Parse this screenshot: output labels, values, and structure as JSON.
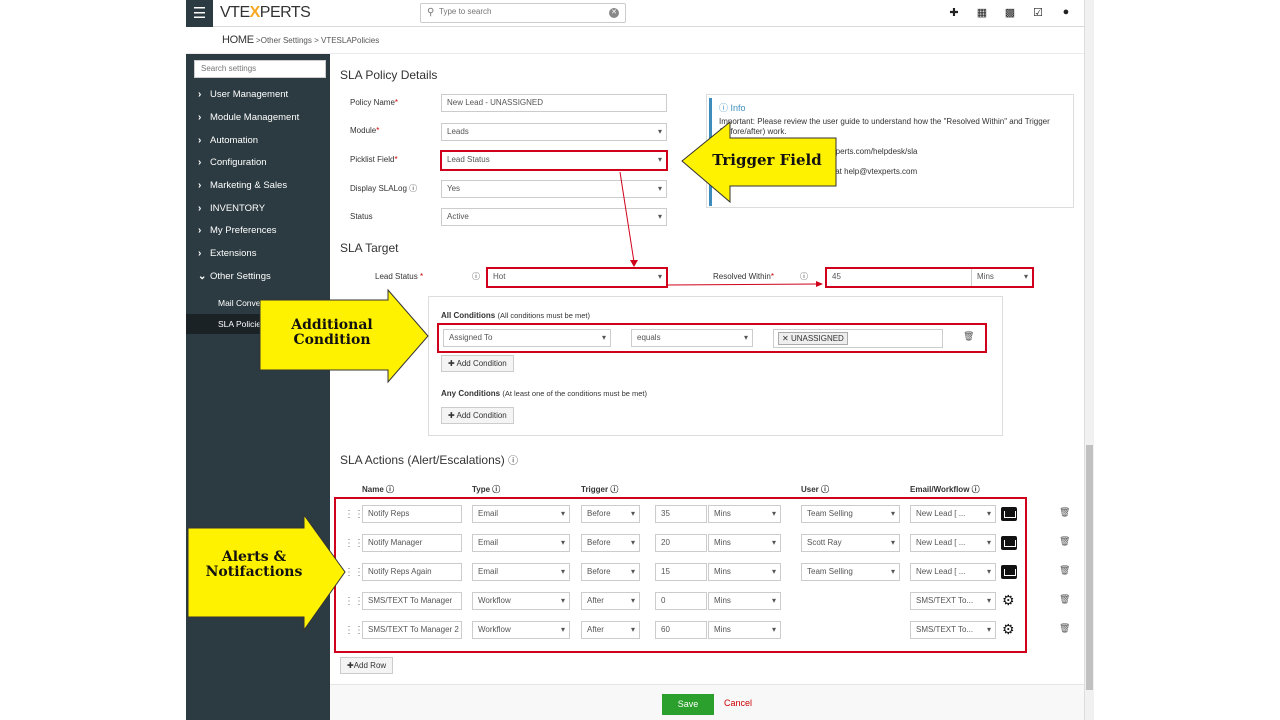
{
  "topbar": {
    "logo_pre": "VTE",
    "logo_x": "X",
    "logo_post": "PERTS",
    "search_placeholder": "Type to search"
  },
  "breadcrumb": {
    "home": "HOME",
    "sep1": " >",
    "item1": "Other Settings",
    "sep2": " > ",
    "item2": "VTESLAPolicies"
  },
  "sidebar": {
    "search_placeholder": "Search settings",
    "items": [
      "User Management",
      "Module Management",
      "Automation",
      "Configuration",
      "Marketing & Sales",
      "INVENTORY",
      "My Preferences",
      "Extensions",
      "Other Settings"
    ],
    "sub": [
      "Mail Converter",
      "SLA Policies"
    ]
  },
  "policy": {
    "title": "SLA Policy Details",
    "fields": [
      {
        "label": "Policy Name",
        "req": "*",
        "value": "New Lead - UNASSIGNED"
      },
      {
        "label": "Module",
        "req": "*",
        "value": "Leads"
      },
      {
        "label": "Picklist Field",
        "req": "*",
        "value": "Lead Status"
      },
      {
        "label": "Display SLALog",
        "req": "",
        "value": "Yes"
      },
      {
        "label": "Status",
        "req": "",
        "value": "Active"
      }
    ]
  },
  "info": {
    "title": "Info",
    "line1": "Important: Please review the user guide to understand how the \"Resolved Within\" and Trigger",
    "line2": "(before/after) work.",
    "line3": "texperts.com/helpdesk/sla",
    "line4": "ail at help@vtexperts.com"
  },
  "target": {
    "title": "SLA Target",
    "lead_status_label": "Lead Status",
    "lead_status_value": "Hot",
    "resolved_label": "Resolved Within",
    "resolved_value": "45",
    "resolved_unit": "Mins"
  },
  "conditions": {
    "all_title": "All Conditions",
    "all_note": "(All conditions must be met)",
    "field": "Assigned To",
    "op": "equals",
    "tag": "UNASSIGNED",
    "add": "Add Condition",
    "any_title": "Any Conditions",
    "any_note": "(At least one of the conditions must be met)"
  },
  "actions": {
    "title": "SLA Actions (Alert/Escalations)",
    "cols": [
      "Name",
      "Type",
      "Trigger",
      "User",
      "Email/Workflow"
    ],
    "rows": [
      {
        "name": "Notify Reps",
        "type": "Email",
        "trigger": "Before",
        "num": "35",
        "unit": "Mins",
        "user": "Team Selling",
        "wf": "New Lead [ ..."
      },
      {
        "name": "Notify Manager",
        "type": "Email",
        "trigger": "Before",
        "num": "20",
        "unit": "Mins",
        "user": "Scott Ray",
        "wf": "New Lead [ ..."
      },
      {
        "name": "Notify Reps Again",
        "type": "Email",
        "trigger": "Before",
        "num": "15",
        "unit": "Mins",
        "user": "Team Selling",
        "wf": "New Lead [ ..."
      },
      {
        "name": "SMS/TEXT To Manager",
        "type": "Workflow",
        "trigger": "After",
        "num": "0",
        "unit": "Mins",
        "user": "",
        "wf": "SMS/TEXT To..."
      },
      {
        "name": "SMS/TEXT To Manager 2",
        "type": "Workflow",
        "trigger": "After",
        "num": "60",
        "unit": "Mins",
        "user": "",
        "wf": "SMS/TEXT To..."
      }
    ],
    "add_row": "Add Row"
  },
  "footer": {
    "save": "Save",
    "cancel": "Cancel"
  },
  "callouts": {
    "trigger": "Trigger Field",
    "additional": "Additional Condition",
    "alerts": "Alerts & Notifactions"
  }
}
